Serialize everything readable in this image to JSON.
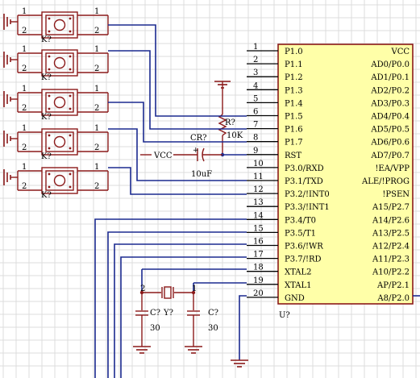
{
  "mcu": {
    "designator": "U?",
    "left_pins": [
      {
        "num": "1",
        "name": "P1.0"
      },
      {
        "num": "2",
        "name": "P1.1"
      },
      {
        "num": "3",
        "name": "P1.2"
      },
      {
        "num": "4",
        "name": "P1.3"
      },
      {
        "num": "5",
        "name": "P1.4"
      },
      {
        "num": "6",
        "name": "P1.5"
      },
      {
        "num": "7",
        "name": "P1.6"
      },
      {
        "num": "8",
        "name": "P1.7"
      },
      {
        "num": "9",
        "name": "RST"
      },
      {
        "num": "10",
        "name": "P3.0/RXD"
      },
      {
        "num": "11",
        "name": "P3.1/TXD"
      },
      {
        "num": "12",
        "name": "P3.2/!INT0"
      },
      {
        "num": "13",
        "name": "P3.3/!INT1"
      },
      {
        "num": "14",
        "name": "P3.4/T0"
      },
      {
        "num": "15",
        "name": "P3.5/T1"
      },
      {
        "num": "16",
        "name": "P3.6/!WR"
      },
      {
        "num": "17",
        "name": "P3.7/!RD"
      },
      {
        "num": "18",
        "name": "XTAL2"
      },
      {
        "num": "19",
        "name": "XTAL1"
      },
      {
        "num": "20",
        "name": "GND"
      }
    ],
    "right_pins": [
      "VCC",
      "AD0/P0.0",
      "AD1/P0.1",
      "AD2/P0.2",
      "AD3/P0.3",
      "AD4/P0.4",
      "AD5/P0.5",
      "AD6/P0.6",
      "AD7/P0.7",
      "!EA/VPP",
      "ALE/!PROG",
      "!PSEN",
      "A15/P2.7",
      "A14/P2.6",
      "A13/P2.5",
      "A12/P2.4",
      "A11/P2.3",
      "A10/P2.2",
      "AP/P2.1",
      "A8/P2.0"
    ]
  },
  "switches": {
    "designator": "K?",
    "pin1": "1",
    "pin2": "2",
    "count": 5
  },
  "resistor": {
    "designator": "R?",
    "value": "10K"
  },
  "reset_cap": {
    "designator": "CR?",
    "value": "10uF",
    "net": "VCC"
  },
  "crystal": {
    "designator": "Y?",
    "pin1": "1",
    "pin2": "2"
  },
  "load_caps": [
    {
      "designator": "C?",
      "value": "30"
    },
    {
      "designator": "C?",
      "value": "30"
    }
  ]
}
